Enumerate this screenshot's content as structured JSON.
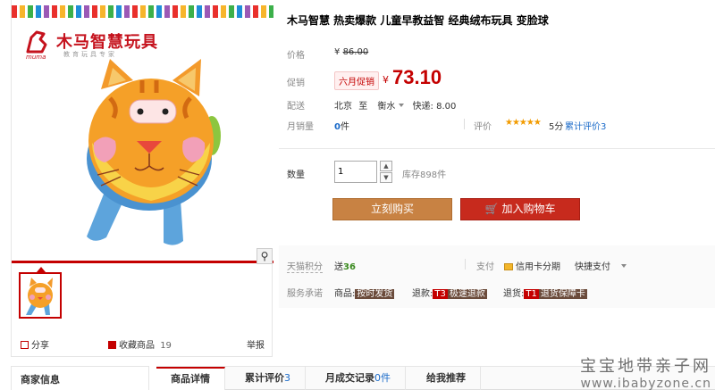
{
  "gallery": {
    "brand_name": "木马智慧玩具",
    "brand_tagline": "教育玩具专家",
    "brand_mark": "muma",
    "zoom_icon": "magnifier-icon",
    "share_label": "分享",
    "collect_label": "收藏商品",
    "collect_count": "19",
    "report_label": "举报"
  },
  "product": {
    "title": "木马智慧 热卖爆款 儿童早教益智 经典绒布玩具 变脸球",
    "price_label": "价格",
    "orig_yen": "¥",
    "orig_price": "86.00",
    "promo_label": "促销",
    "promo_tag": "六月促销",
    "promo_yen": "¥",
    "promo_price": "73.10",
    "ship_label": "配送",
    "ship_from": "北京",
    "ship_to_word": "至",
    "ship_dest": "衡水",
    "ship_method": "快递: 8.00",
    "sales_label": "月销量",
    "sales_count": "0",
    "sales_unit": "件",
    "rate_label": "评价",
    "stars": "★★★★★",
    "rate_score": "5分",
    "rate_count": "累计评价3",
    "qty_label": "数量",
    "qty_value": "1",
    "qty_up": "▲",
    "qty_down": "▼",
    "stock": "库存898件",
    "buy_label": "立刻购买",
    "cart_label": "加入购物车"
  },
  "services": {
    "points_label": "天猫积分",
    "points_prefix": "送",
    "points_value": "36",
    "pay_label": "支付",
    "pay_credit": "信用卡分期",
    "pay_quick": "快捷支付",
    "promise_label": "服务承诺",
    "promise1_prefix": "商品:",
    "promise1_tag": "按时发货",
    "promise2_prefix": "退款:",
    "promise2_code": "T3",
    "promise2_tag": "极速退款",
    "promise3_prefix": "退货:",
    "promise3_code": "T1",
    "promise3_tag": "退货保障卡"
  },
  "bottom": {
    "seller_title": "商家信息",
    "tabs": [
      {
        "label": "商品详情",
        "count": ""
      },
      {
        "label": "累计评价",
        "count": "3"
      },
      {
        "label": "月成交记录",
        "count": "0件"
      },
      {
        "label": "给我推荐",
        "count": ""
      }
    ]
  },
  "watermark": {
    "line1": "宝宝地带亲子网",
    "line2": "www.ibabyzone.cn"
  },
  "colors": {
    "accent_red": "#c40000",
    "buy_button": "#c88243",
    "cart_button": "#c72a1d",
    "link_blue": "#1a6ac9"
  }
}
